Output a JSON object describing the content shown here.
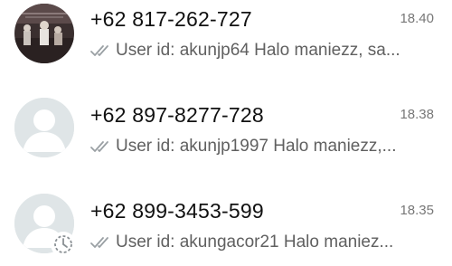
{
  "chats": [
    {
      "name": "+62 817-262-727",
      "time": "18.40",
      "preview": "User id: akunjp64  Halo maniezz, sa...",
      "avatar": "photo-avatar",
      "tick_icon": "double-check-icon"
    },
    {
      "name": "+62 897-8277-728",
      "time": "18.38",
      "preview": "User id: akunjp1997  Halo maniezz,...",
      "avatar": "default-person-avatar",
      "tick_icon": "double-check-icon"
    },
    {
      "name": "+62 899-3453-599",
      "time": "18.35",
      "preview": "User id: akungacor21  Halo maniez...",
      "avatar": "default-person-avatar",
      "tick_icon": "double-check-icon",
      "badge": "timer-icon"
    }
  ],
  "colors": {
    "text_primary": "#111111",
    "text_secondary": "#606060",
    "time": "#777777",
    "tick": "#9aa0a4",
    "avatar_bg": "#dfe5e7"
  }
}
